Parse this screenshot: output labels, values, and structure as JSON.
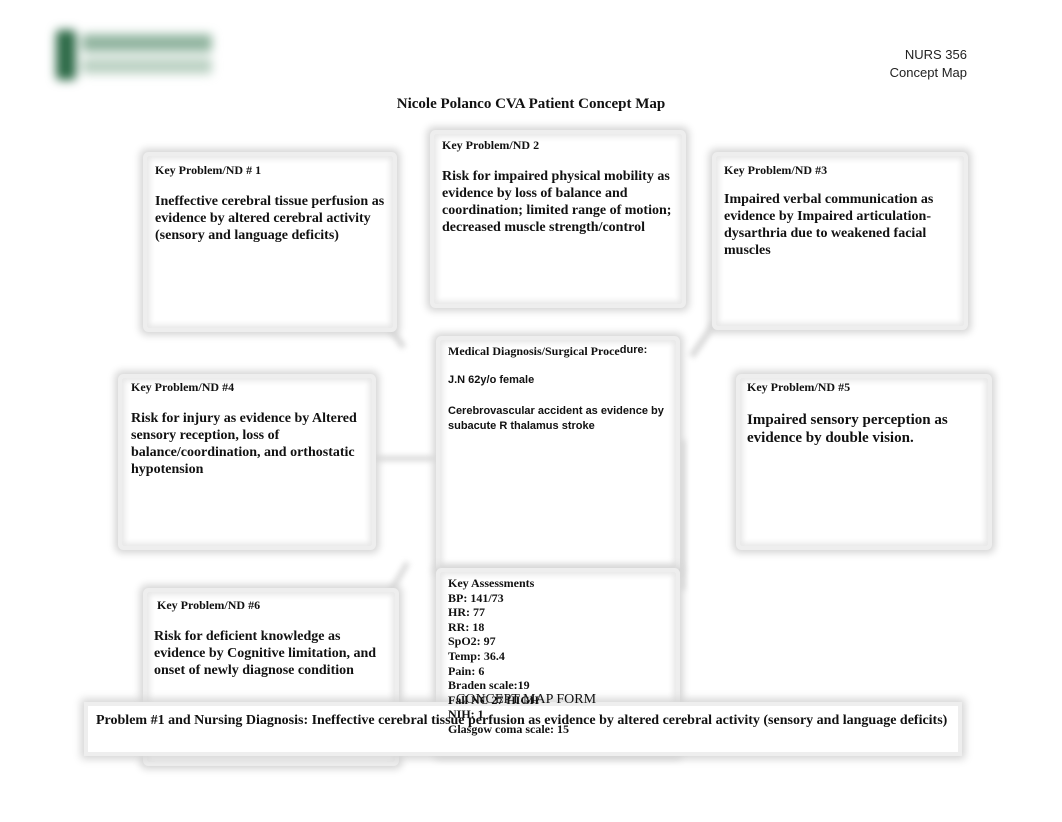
{
  "header": {
    "logo": "school-logo",
    "course_code": "NURS 356",
    "doc_type": "Concept Map"
  },
  "title": "Nicole Polanco CVA Patient Concept Map",
  "problems": [
    {
      "heading": "Key Problem/ND # 1",
      "text": "Ineffective cerebral tissue perfusion as evidence by altered cerebral activity (sensory and language deficits)"
    },
    {
      "heading": "Key Problem/ND 2",
      "text": "Risk for impaired physical mobility as evidence by loss of balance and coordination; limited range of motion; decreased muscle strength/control"
    },
    {
      "heading": "Key Problem/ND #3",
      "text": "Impaired verbal communication as evidence by Impaired articulation-dysarthria due to weakened facial muscles"
    },
    {
      "heading": "Key Problem/ND #4",
      "text": "Risk for injury as evidence by Altered sensory reception, loss of balance/coordination, and orthostatic hypotension"
    },
    {
      "heading": "Key Problem/ND #5",
      "text": "Impaired sensory perception as evidence by double vision."
    },
    {
      "heading": "Key Problem/ND #6",
      "text": "Risk for deficient knowledge as evidence by Cognitive limitation, and onset of newly diagnose condition"
    }
  ],
  "medical": {
    "heading_a": "Medical Diagnosis/Surgical Proce",
    "heading_b": "dure:",
    "patient": "J.N 62y/o female",
    "diagnosis": "Cerebrovascular accident as evidence by subacute R thalamus stroke"
  },
  "assessments": {
    "heading": "Key Assessments",
    "items": [
      "BP: 141/73",
      "HR: 77",
      "RR: 18",
      "SpO2: 97",
      "Temp: 36.4",
      "Pain: 6",
      "Braden scale:19"
    ],
    "fall": "Fall NC 27 HIGH",
    "nih": "NIH: 1",
    "gcs": "Glasgow coma scale: 15"
  },
  "form_title": "CONCEPT MAP FORM",
  "problem_statement": "Problem #1 and Nursing Diagnosis: Ineffective cerebral tissue perfusion as evidence by altered cerebral activity (sensory and language deficits)"
}
